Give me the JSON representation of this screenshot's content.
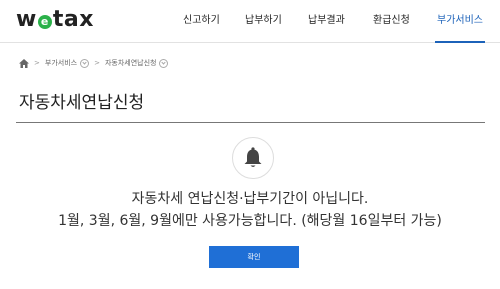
{
  "logo": {
    "text_before": "w",
    "e_letter": "e",
    "text_after": "tax"
  },
  "nav": [
    {
      "label": "신고하기"
    },
    {
      "label": "납부하기"
    },
    {
      "label": "납부결과"
    },
    {
      "label": "환급신청"
    },
    {
      "label": "부가서비스"
    }
  ],
  "colors": {
    "accent": "#1c62b9",
    "button": "#1f6fd6",
    "logo_green": "#2bb14a"
  },
  "breadcrumb": {
    "home_icon": "home-icon",
    "level1": "부가서비스",
    "level2": "자동차세연납신청"
  },
  "page": {
    "title": "자동차세연납신청"
  },
  "notice": {
    "icon": "bell-icon",
    "line1": "자동차세 연납신청·납부기간이 아닙니다.",
    "line2": "1월, 3월, 6월, 9월에만 사용가능합니다. (해당월 16일부터 가능)",
    "confirm_label": "확인"
  }
}
